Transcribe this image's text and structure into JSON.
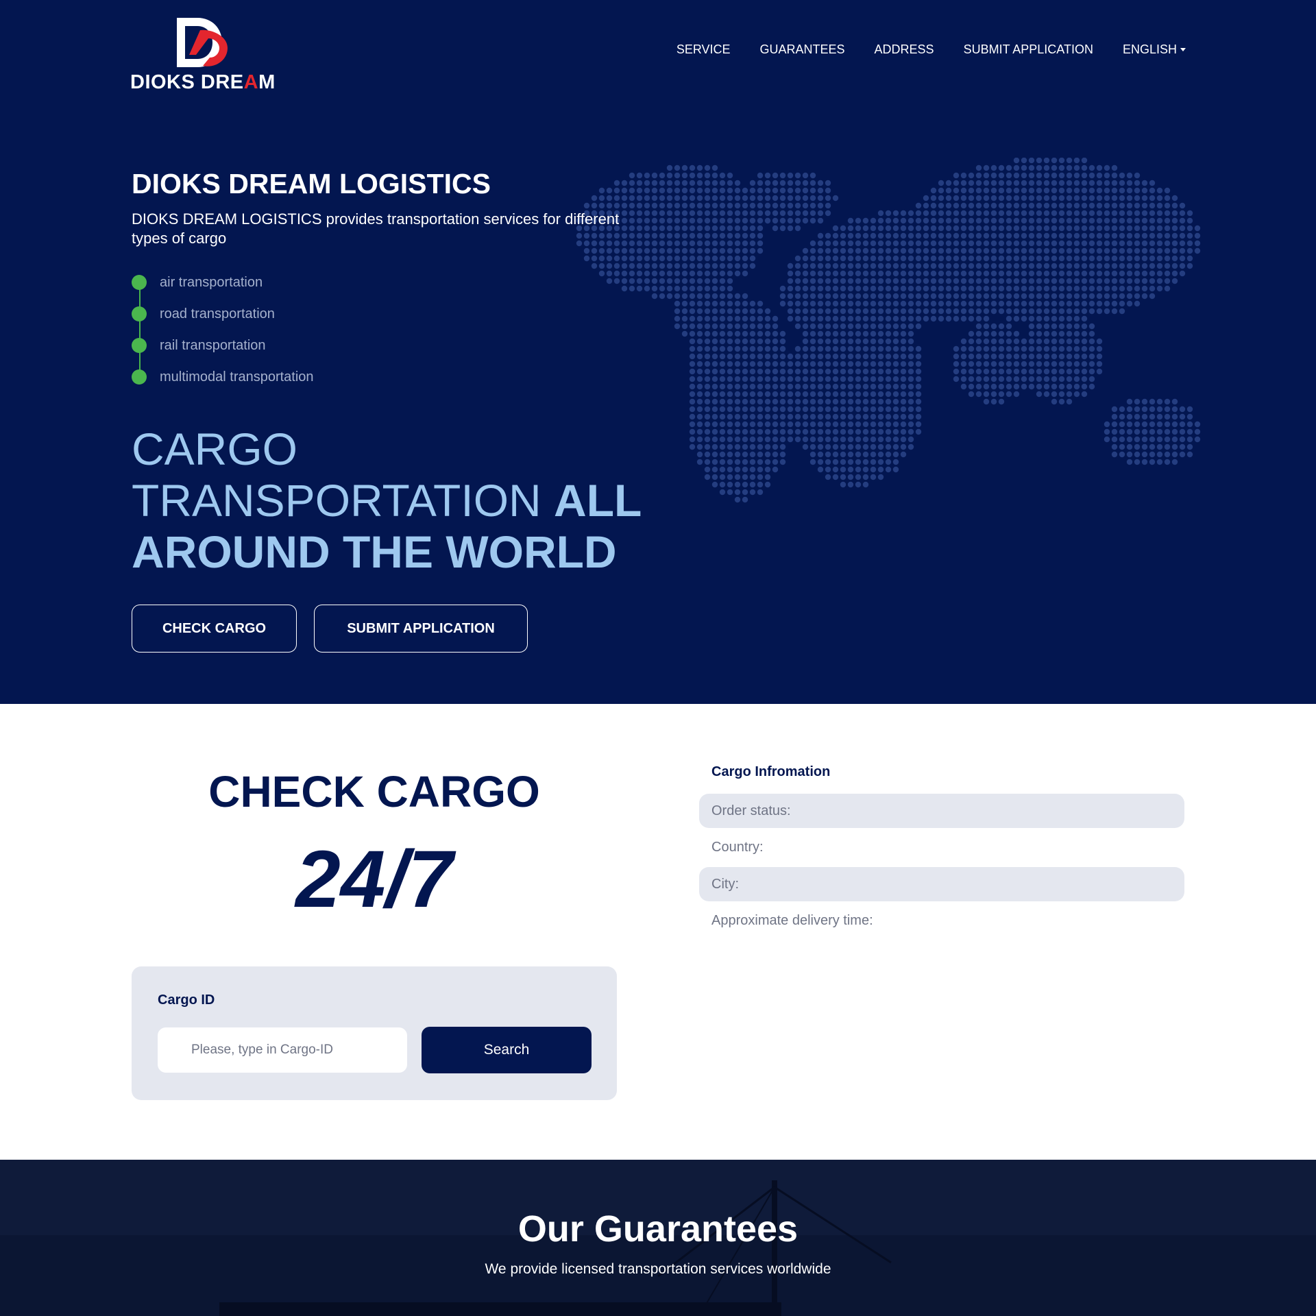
{
  "brand": {
    "name_prefix": "DIOKS DRE",
    "name_accent": "A",
    "name_suffix": "M",
    "colors": {
      "navy": "#031650",
      "red": "#e3262e",
      "green": "#4bb64e",
      "light_blue": "#9ec8ef"
    }
  },
  "nav": {
    "items": [
      "SERVICE",
      "GUARANTEES",
      "ADDRESS",
      "SUBMIT APPLICATION"
    ],
    "language": "ENGLISH"
  },
  "hero": {
    "title": "DIOKS DREAM LOGISTICS",
    "description": "DIOKS DREAM LOGISTICS provides transportation services for different types of cargo",
    "services": [
      "air transportation",
      "road transportation",
      "rail transportation",
      "multimodal transportation"
    ],
    "headline_line1": "CARGO",
    "headline_line2_light": "TRANSPORTATION ",
    "headline_line2_bold": "ALL",
    "headline_line3": "AROUND THE WORLD",
    "buttons": {
      "check": "CHECK CARGO",
      "submit": "SUBMIT APPLICATION"
    }
  },
  "check": {
    "title": "CHECK CARGO",
    "availability": "24/7",
    "search": {
      "label": "Cargo ID",
      "placeholder": "Please, type in Cargo-ID",
      "button": "Search"
    }
  },
  "info": {
    "title": "Cargo Infromation",
    "fields": [
      "Order status:",
      "Country:",
      "City:",
      "Approximate delivery time:"
    ]
  },
  "guarantees": {
    "title": "Our Guarantees",
    "subtitle": "We provide licensed transportation services worldwide"
  }
}
